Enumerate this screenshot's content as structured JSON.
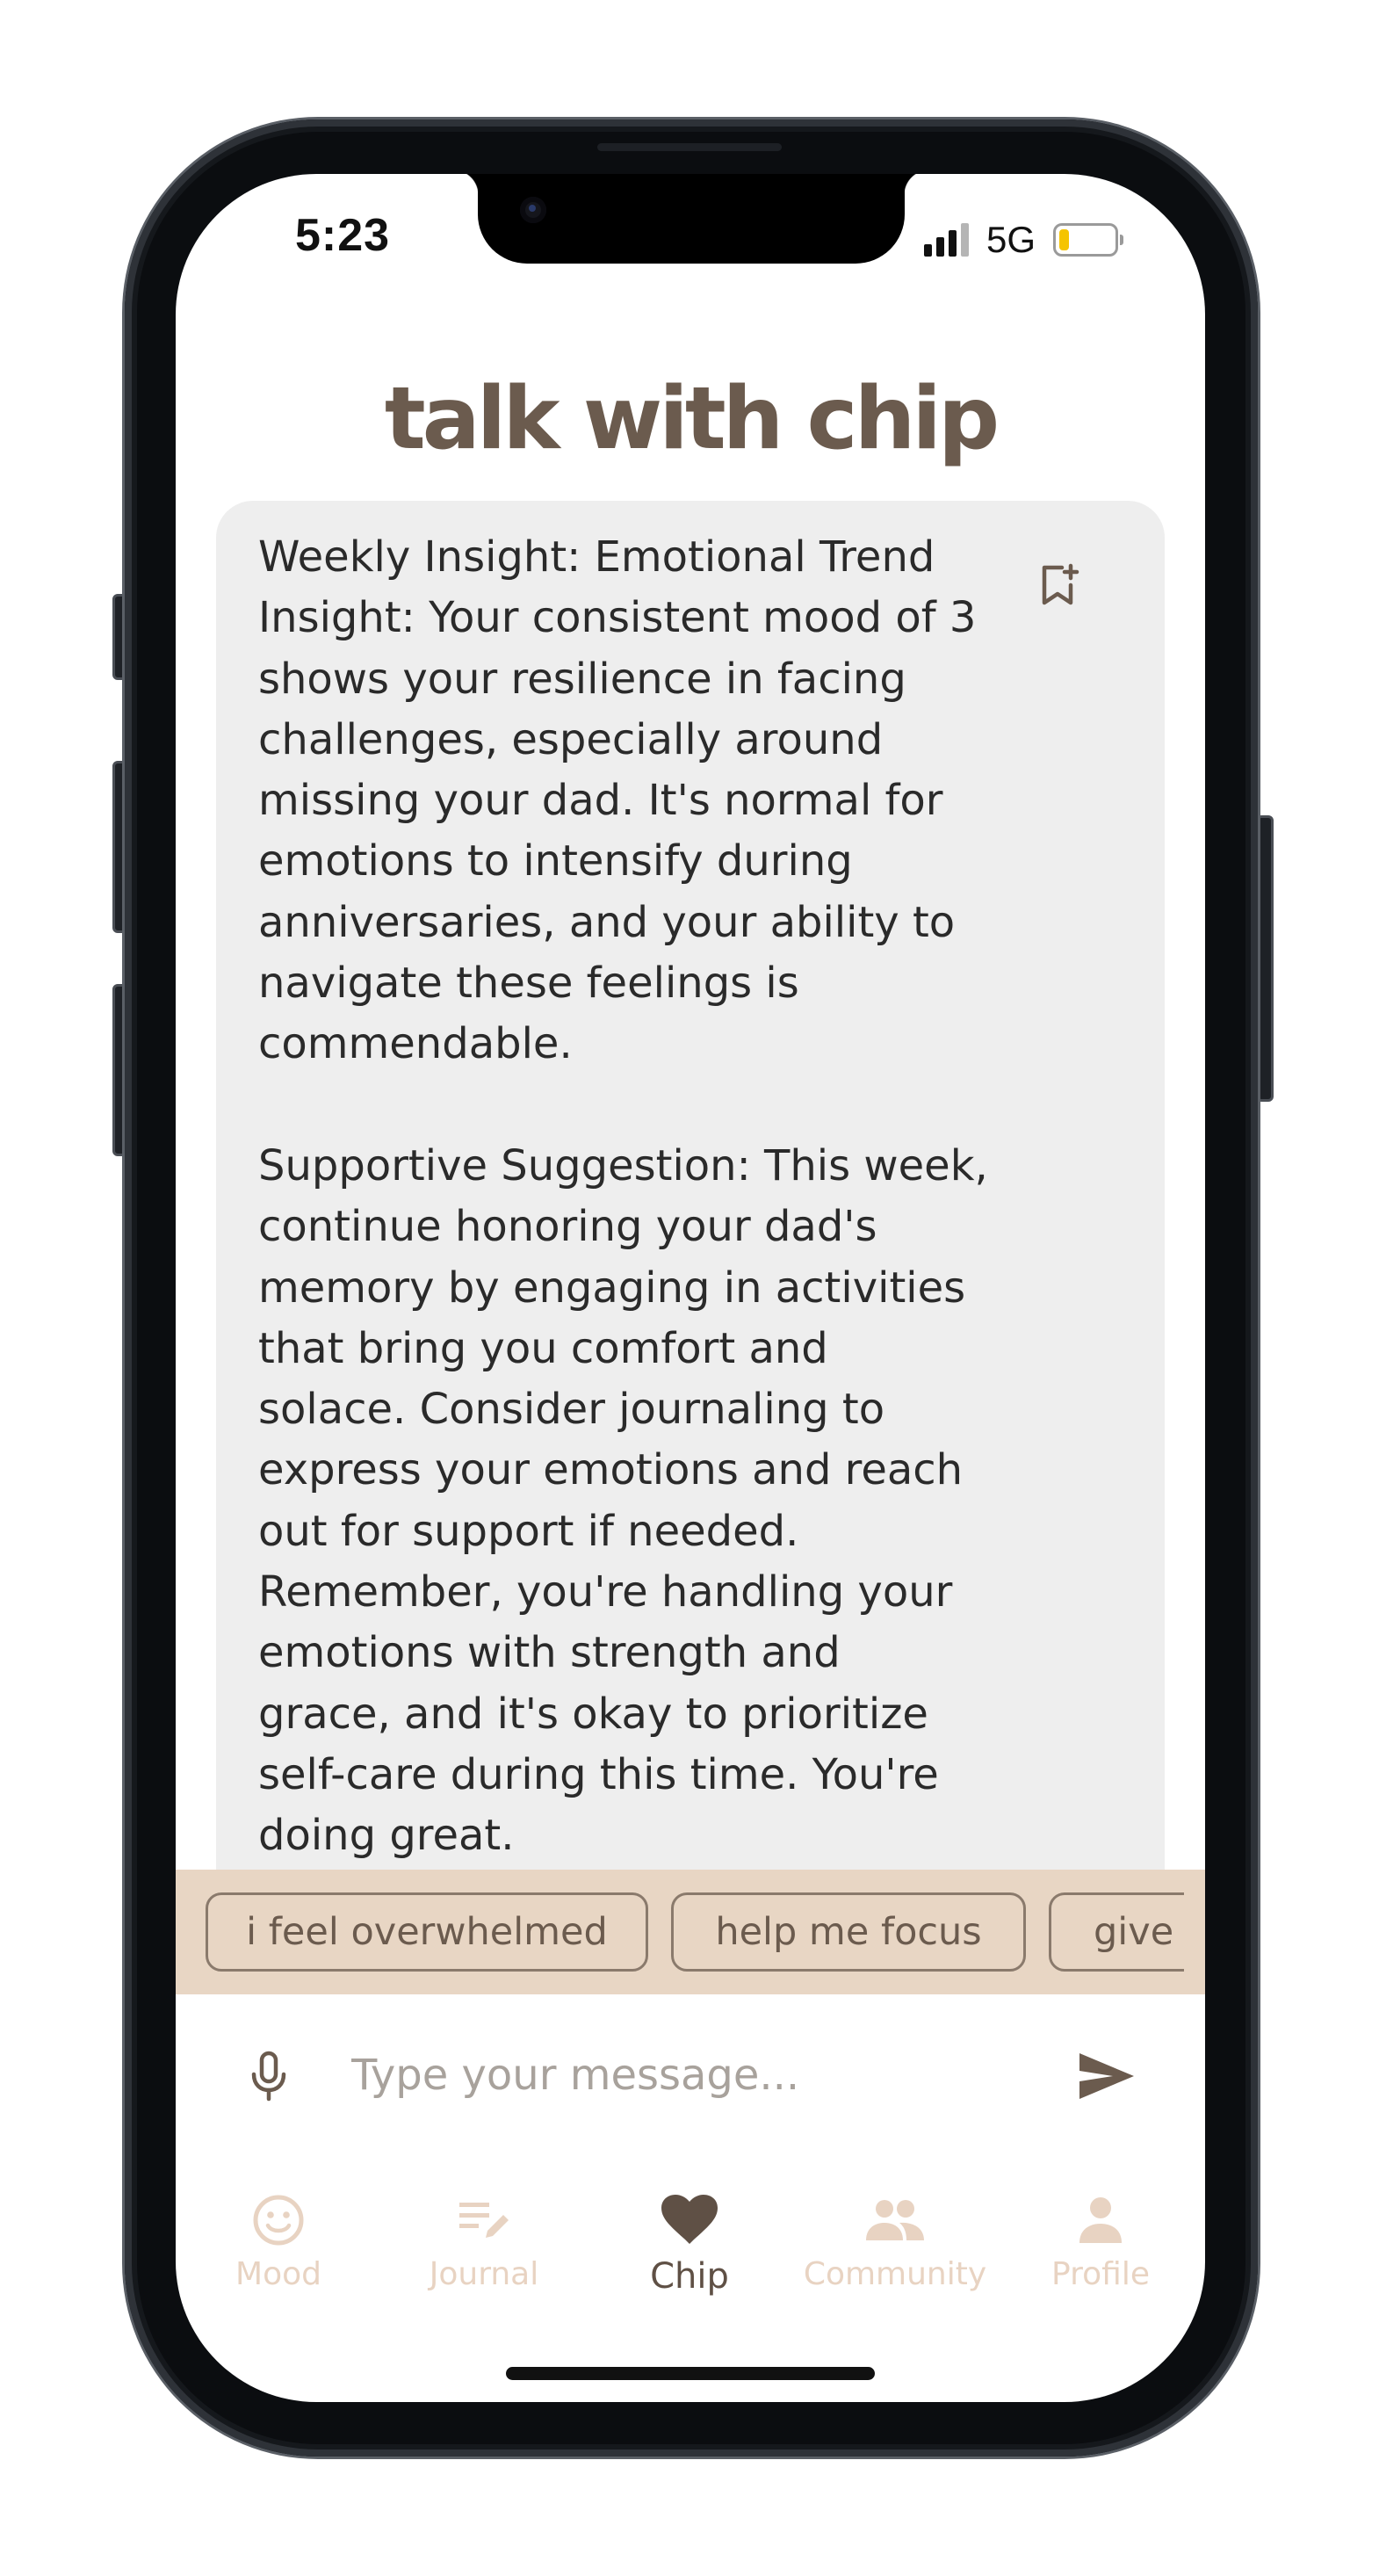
{
  "status_bar": {
    "time": "5:23",
    "network": "5G",
    "battery_level": 0.2,
    "battery_color": "#f5c400"
  },
  "header": {
    "title": "talk with chip"
  },
  "message": {
    "text": "Weekly Insight: Emotional Trend\nInsight: Your consistent mood of 3\nshows your resilience in facing\nchallenges, especially around\nmissing your dad. It's normal for\nemotions to intensify during\nanniversaries, and your ability to\nnavigate these feelings is\ncommendable.\n\nSupportive Suggestion: This week,\ncontinue honoring your dad's\nmemory by engaging in activities\nthat bring you comfort and\nsolace. Consider journaling to\nexpress your emotions and reach\nout for support if needed.\nRemember, you're handling your\nemotions with strength and\ngrace, and it's okay to prioritize\nself-care during this time. You're\ndoing great.",
    "bookmark_icon": "bookmark-add-icon"
  },
  "suggestions": [
    {
      "label": "i feel overwhelmed"
    },
    {
      "label": "help me focus"
    },
    {
      "label": "give"
    }
  ],
  "input": {
    "placeholder": "Type your message...",
    "value": "",
    "mic_icon": "microphone-icon",
    "send_icon": "send-icon"
  },
  "nav": {
    "items": [
      {
        "label": "Mood",
        "icon": "smiley-icon",
        "active": false
      },
      {
        "label": "Journal",
        "icon": "journal-edit-icon",
        "active": false
      },
      {
        "label": "Chip",
        "icon": "heart-icon",
        "active": true
      },
      {
        "label": "Community",
        "icon": "people-icon",
        "active": false
      },
      {
        "label": "Profile",
        "icon": "person-icon",
        "active": false
      }
    ]
  },
  "colors": {
    "brand_brown": "#6b5b4e",
    "suggestion_bar": "#e8d6c4",
    "card_background": "#eeeeee",
    "nav_inactive": "#e8d3c2",
    "nav_active": "#5f5045"
  }
}
